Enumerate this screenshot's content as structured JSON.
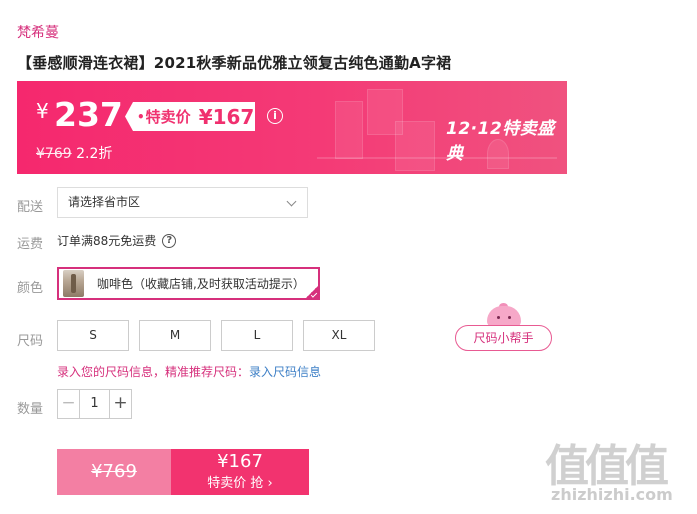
{
  "brand": "梵希蔓",
  "product_title": "【垂感顺滑连衣裙】2021秋季新品优雅立领复古纯色通勤A字裙",
  "price": {
    "currency": "¥",
    "current": "237",
    "sale_dot": "•",
    "sale_label": "特卖价",
    "sale_value": "¥167",
    "info_symbol": "i",
    "original": "¥769",
    "discount": "2.2折",
    "festival": "12·12特卖盛典"
  },
  "delivery": {
    "label": "配送",
    "placeholder": "请选择省市区"
  },
  "shipping": {
    "label": "运费",
    "text": "订单满88元免运费",
    "help_symbol": "?"
  },
  "color": {
    "label": "颜色",
    "selected": "咖啡色（收藏店铺,及时获取活动提示）"
  },
  "size": {
    "label": "尺码",
    "options": [
      "S",
      "M",
      "L",
      "XL"
    ],
    "helper": "尺码小帮手",
    "hint": "录入您的尺码信息，精准推荐尺码：",
    "hint_link": "录入尺码信息"
  },
  "quantity": {
    "label": "数量",
    "minus": "−",
    "value": "1",
    "plus": "+"
  },
  "buy": {
    "original": "¥769",
    "sale_value": "¥167",
    "sale_label": "特卖价 抢 ›"
  },
  "watermark": {
    "logo": "值值值",
    "url": "zhizhizhi.com"
  },
  "colors": {
    "accent": "#d6307c",
    "banner": "#f5286e",
    "buy_sale": "#f2336f",
    "buy_orig": "#f37fa3",
    "link": "#3d7fc6"
  }
}
